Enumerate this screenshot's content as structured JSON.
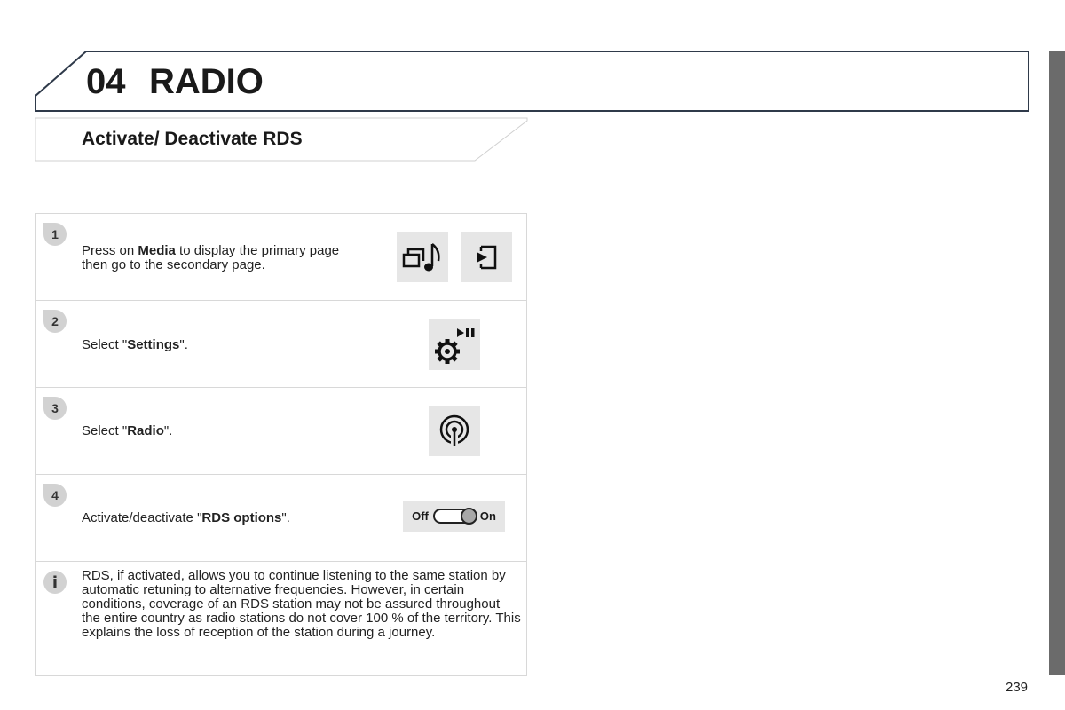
{
  "chapter": {
    "number": "04",
    "title": "RADIO"
  },
  "section": {
    "title": "Activate/ Deactivate RDS"
  },
  "steps": [
    {
      "badge": "1",
      "text_parts": [
        "Press on ",
        "Media",
        " to display the primary page",
        "then go to the secondary page."
      ],
      "icons": [
        "media-icon",
        "secondary-page-icon"
      ]
    },
    {
      "badge": "2",
      "text_parts": [
        "Select \"",
        "Settings",
        "\"."
      ],
      "icons": [
        "settings-icon"
      ]
    },
    {
      "badge": "3",
      "text_parts": [
        "Select \"",
        "Radio",
        "\"."
      ],
      "icons": [
        "radio-icon"
      ]
    },
    {
      "badge": "4",
      "text_parts": [
        "Activate/deactivate \"",
        "RDS options",
        "\"."
      ],
      "toggle": {
        "off_label": "Off",
        "on_label": "On",
        "state": "on"
      }
    }
  ],
  "info": {
    "badge": "i",
    "text": "RDS, if activated, allows you to continue listening to the same station by automatic retuning to alternative frequencies. However, in certain conditions, coverage of an RDS station may not be assured throughout the entire country as radio stations do not cover 100 % of the territory. This explains the loss of reception of the station during a journey."
  },
  "page_number": "239",
  "colors": {
    "frame": "#2f3a4a",
    "side_tab": "#6b6b6b",
    "icon_bg": "#e6e6e6",
    "badge_bg": "#d2d2d2"
  }
}
